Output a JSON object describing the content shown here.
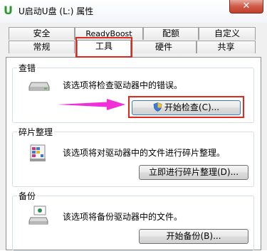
{
  "window": {
    "title": "U启动U盘 (L:) 属性",
    "close_label": "✕"
  },
  "tabs": {
    "row1": [
      "安全",
      "ReadyBoost",
      "配额",
      "自定义"
    ],
    "row2": [
      "常规",
      "工具",
      "硬件",
      "共享"
    ],
    "active": "工具"
  },
  "check": {
    "title": "查错",
    "description": "该选项将检查驱动器中的错误。",
    "button_label": "开始检查(C)..."
  },
  "defrag": {
    "title": "碎片整理",
    "description": "该选项将对驱动器中的文件进行碎片整理。",
    "button_label": "立即进行碎片整理(D)..."
  },
  "backup": {
    "title": "备份",
    "description": "该选项将备份驱动器中的文件。",
    "button_label": "开始备份(B)..."
  },
  "colors": {
    "highlight": "#e0281e",
    "arrow": "#f02fd8"
  }
}
